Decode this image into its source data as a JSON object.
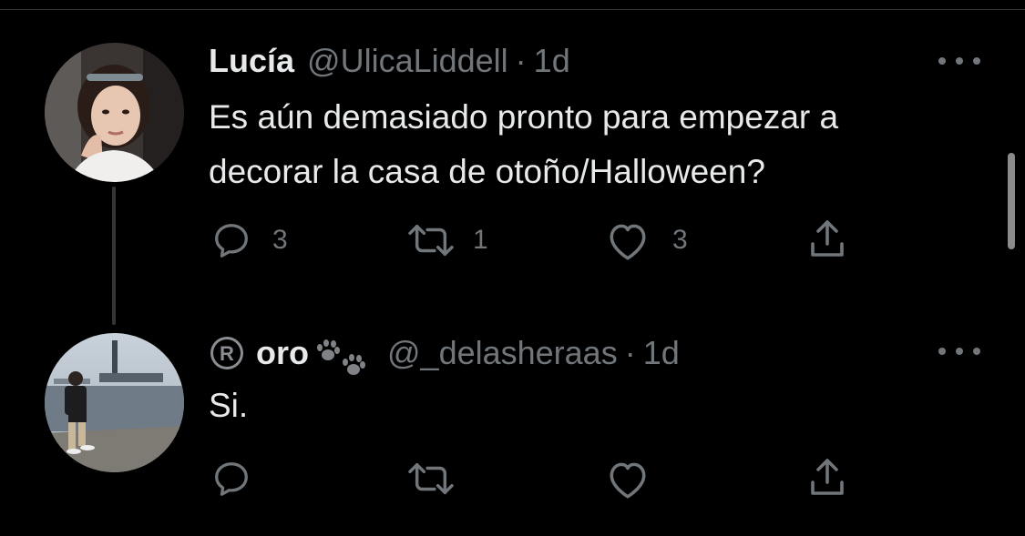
{
  "tweets": [
    {
      "display_name": "Lucía",
      "handle": "@UlicaLiddell",
      "separator": "·",
      "time": "1d",
      "text_lines": [
        "Es aún demasiado pronto para empezar a",
        "decorar la casa de otoño/Halloween?"
      ],
      "counts": {
        "replies": "3",
        "retweets": "1",
        "likes": "3"
      }
    },
    {
      "display_name": "oro",
      "handle": "@_delasheraas",
      "separator": "·",
      "time": "1d",
      "text_lines": [
        "Si."
      ],
      "counts": {
        "replies": "",
        "retweets": "",
        "likes": ""
      }
    }
  ],
  "icons": {
    "reply": "reply-icon",
    "retweet": "retweet-icon",
    "like": "heart-icon",
    "share": "share-icon",
    "more": "more-icon",
    "registered": "registered-icon",
    "paw": "paw-prints-icon"
  },
  "colors": {
    "background": "#000000",
    "text_primary": "#e7e9ea",
    "text_secondary": "#71767b",
    "thread_line": "#333639"
  }
}
